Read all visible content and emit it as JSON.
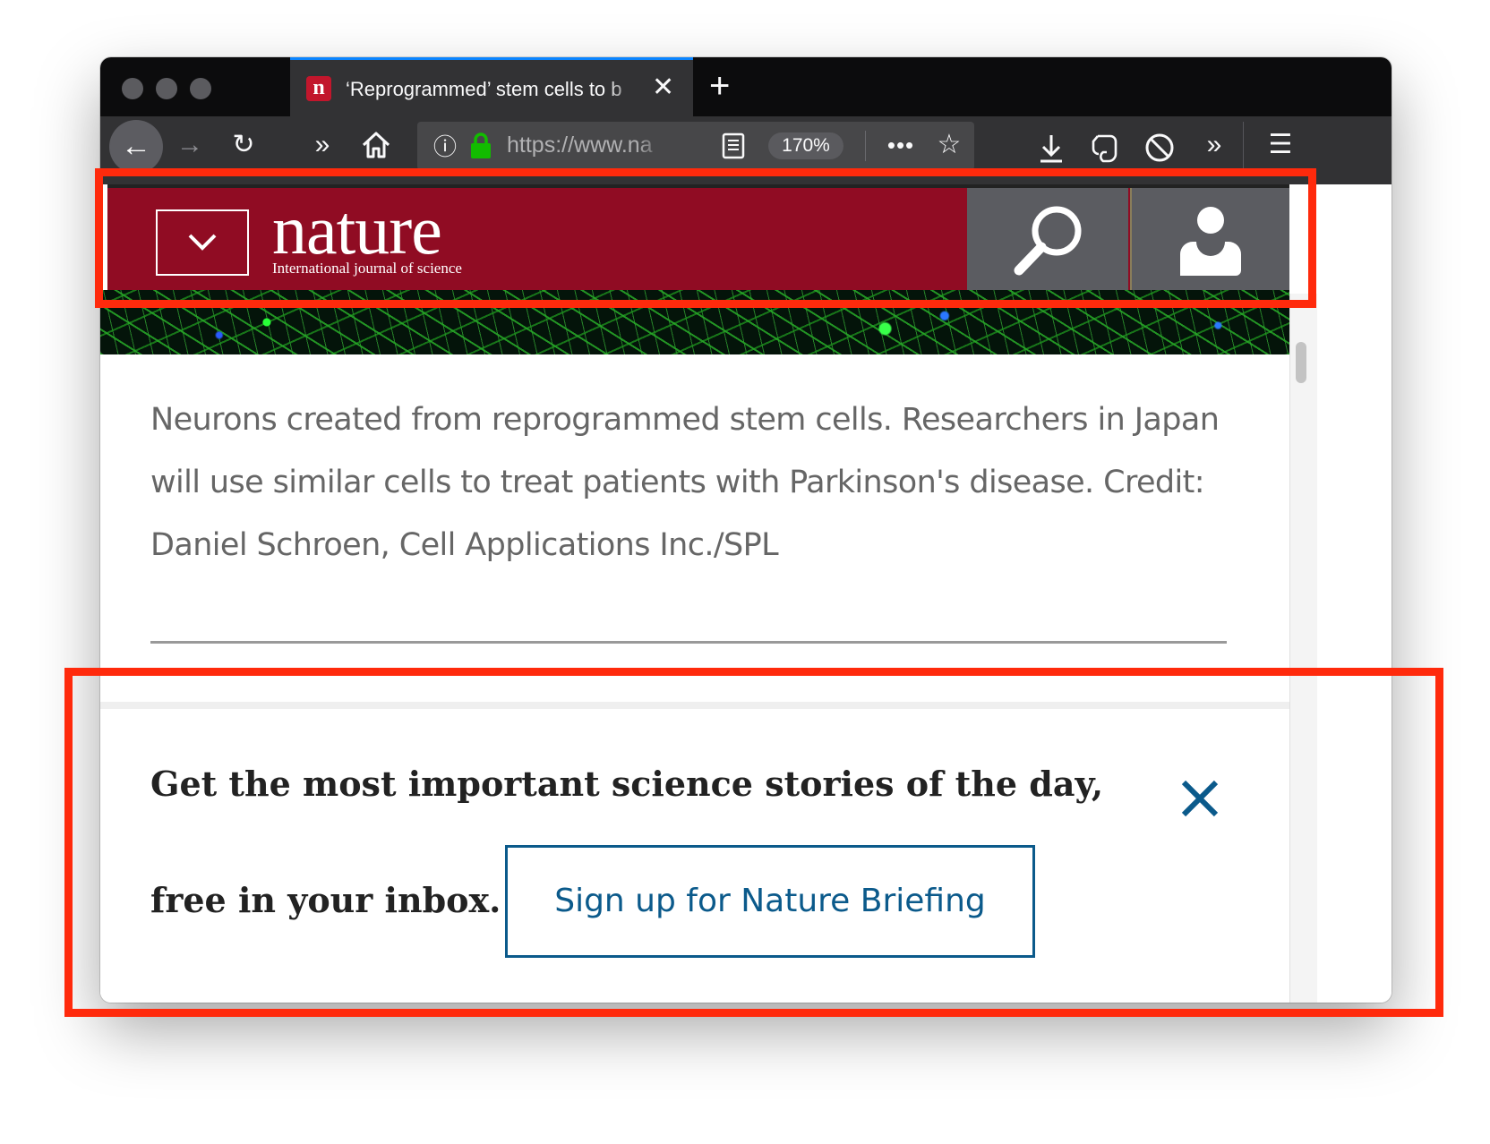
{
  "browser": {
    "tab_title": "‘Reprogrammed’ stem cells to b",
    "tab_favicon_letter": "n",
    "url": "https://www.na",
    "zoom_level": "170%",
    "icons": [
      "back-icon",
      "forward-icon",
      "reload-icon",
      "overflow-chevrons-icon",
      "home-icon",
      "info-icon",
      "lock-icon",
      "reader-view-icon",
      "page-actions-icon",
      "bookmark-star-icon",
      "download-icon",
      "evernote-icon",
      "block-icon",
      "menu-icon"
    ]
  },
  "header": {
    "logo": "nature",
    "tagline": "International journal of science",
    "bg_color": "#900c23"
  },
  "article": {
    "caption": "Neurons created from reprogrammed stem cells. Researchers in Japan will use similar cells to treat patients with Parkinson's disease.    Credit: Daniel Schroen, Cell Applications Inc./SPL"
  },
  "briefing": {
    "line1": "Get the most important science stories of the day,",
    "line2": "free in your inbox.",
    "button_label": "Sign up for Nature Briefing",
    "accent_color": "#0b5a8b"
  },
  "annotation_color": "#ff2a0c"
}
